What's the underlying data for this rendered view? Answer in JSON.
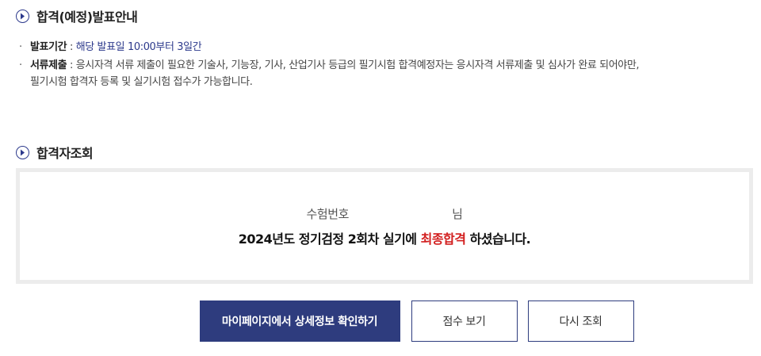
{
  "announcement": {
    "title": "합격(예정)발표안내",
    "items": [
      {
        "label": "발표기간",
        "sep": " : ",
        "value": "해당 발표일 10:00부터 3일간"
      },
      {
        "label": "서류제출",
        "sep": " : ",
        "value_line1": "응시자격 서류 제출이 필요한 기술사, 기능장, 기사, 산업기사 등급의 필기시험 합격예정자는 응시자격 서류제출 및 심사가 완료 되어야만,",
        "value_line2": "필기시험 합격자 등록 및 실기시험 접수가 가능합니다."
      }
    ]
  },
  "lookup": {
    "title": "합격자조회",
    "exam_no_label": "수험번호",
    "honorific": "님",
    "result_prefix": "2024년도 정기검정 2회차 실기에 ",
    "result_highlight": "최종합격",
    "result_suffix": " 하셨습니다."
  },
  "buttons": {
    "mypage": "마이페이지에서 상세정보 확인하기",
    "score": "점수 보기",
    "retry": "다시 조회"
  },
  "colors": {
    "brand": "#2e3c7e",
    "highlight": "#d21e1e",
    "box_border": "#ececec"
  },
  "icons": {
    "section": "chevron-right-circle-icon"
  }
}
